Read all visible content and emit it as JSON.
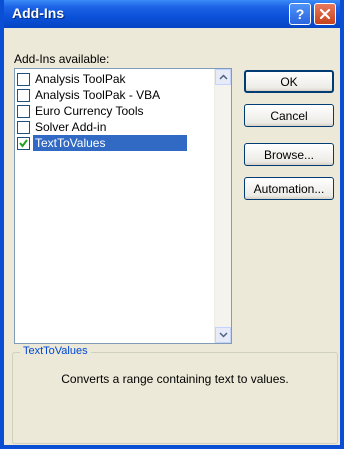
{
  "window": {
    "title": "Add-Ins"
  },
  "addins": {
    "label": "Add-Ins available:",
    "items": [
      {
        "label": "Analysis ToolPak",
        "checked": false
      },
      {
        "label": "Analysis ToolPak - VBA",
        "checked": false
      },
      {
        "label": "Euro Currency Tools",
        "checked": false
      },
      {
        "label": "Solver Add-in",
        "checked": false
      },
      {
        "label": "TextToValues",
        "checked": true
      }
    ]
  },
  "buttons": {
    "ok": "OK",
    "cancel": "Cancel",
    "browse": "Browse...",
    "automation": "Automation..."
  },
  "description": {
    "title": "TextToValues",
    "text": "Converts a range containing text to values."
  },
  "colors": {
    "titlebar": "#0a51d9",
    "selection": "#316ac5",
    "close_button": "#c6421c"
  }
}
